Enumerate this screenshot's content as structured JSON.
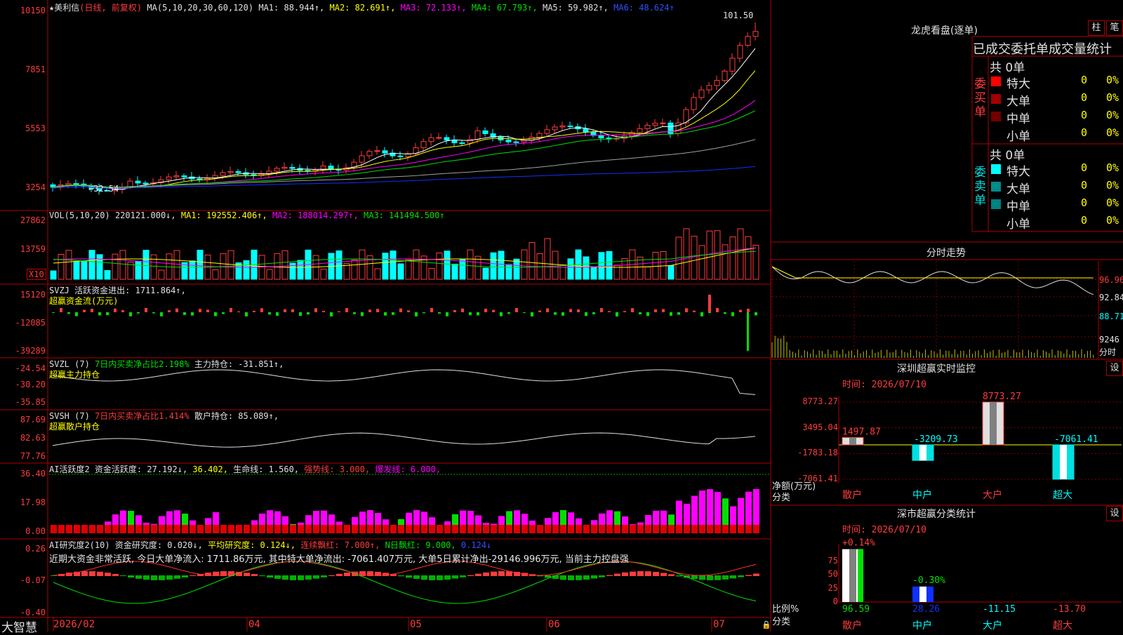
{
  "colors": {
    "up": "#ff3c3c",
    "down": "#00ffff",
    "ma1": "#ffffff",
    "ma2": "#ffff00",
    "ma3": "#ff00ff",
    "ma4": "#00e000",
    "ma5": "#a0a0a0",
    "ma6": "#1030ff",
    "frame": "#b00000"
  },
  "main": {
    "title_star": "★",
    "stock": "美利信",
    "mode": "(日线, 前复权)",
    "ma_def": "MA(5,10,20,30,60,120)",
    "ma1": "MA1: 88.944↑,",
    "ma2": "MA2: 82.691↑,",
    "ma3": "MA3: 72.133↑,",
    "ma4": "MA4: 67.793↑,",
    "ma5": "MA5: 59.982↑,",
    "ma6": "MA6: 48.624↑",
    "high_label": "101.50",
    "low_label": "←32.54",
    "y_ticks": [
      "10150",
      "7851",
      "5553",
      "3254"
    ]
  },
  "vol": {
    "title": "VOL(5,10,20)",
    "v": "220121.000↓,",
    "ma1": "MA1: 192552.406↑,",
    "ma2": "MA2: 188014.297↑,",
    "ma3": "MA3: 141494.500↑",
    "y_ticks": [
      "27862",
      "13759"
    ],
    "unit": "X10"
  },
  "svzj": {
    "title": "SVZJ",
    "line": "活跃资金进出: 1711.864↑,",
    "sub": "超赢资金流(万元)",
    "y_ticks": [
      "15120",
      "-12085",
      "-39289"
    ]
  },
  "svzl": {
    "title": "SVZL  (7)",
    "a": "7日内买卖净占比2.198%",
    "b": "主力持仓: -31.851↑,",
    "sub": "超赢主力持仓",
    "y_ticks": [
      "-24.54",
      "-30.20",
      "-35.85"
    ]
  },
  "svsh": {
    "title": "SVSH  (7)",
    "a": "7日内买卖净占比1.414%",
    "b": "散户持仓: 85.089↑,",
    "sub": "超赢散户持仓",
    "y_ticks": [
      "87.69",
      "82.63",
      "77.76"
    ]
  },
  "ai1": {
    "title": "AI活跃度2",
    "a": "资金活跃度: 27.192↓,",
    "b": "36.402,",
    "c": "生命线: 1.560,",
    "d": "强势线: 3.000,",
    "e": "爆发线: 6.000,",
    "y_ticks": [
      "36.40",
      "17.98",
      "0.00"
    ]
  },
  "ai2": {
    "title": "AI研究度2(10)",
    "a": "资金研究度: 0.020↓,",
    "b": "平均研究度: 0.124↓,",
    "c": "连续飘红: 7.000↑,",
    "d": "N日飘红: 9.000,",
    "e": "0.124↓",
    "comment": "近期大资金非常活跃, 今日大单净流入: 1711.86万元, 其中特大单净流出: -7061.407万元, 大单5日累计净出-29146.996万元, 当前主力控盘强",
    "y_ticks": [
      "0.26",
      "-0.07",
      "-0.40"
    ]
  },
  "xaxis": {
    "brand": "大智慧",
    "labels": [
      "2026/02",
      "04",
      "05",
      "06",
      "07"
    ]
  },
  "longhu": {
    "title": "龙虎看盘(逐单)",
    "btn1": "柱",
    "btn2": "笔",
    "header": "已成交委托单成交量统计",
    "buy_total": "共 0单",
    "sell_total": "共 0单",
    "buy_label": "委买单",
    "sell_label": "委卖单",
    "buy_rows": [
      {
        "name": "特大",
        "v": "0",
        "p": "0%",
        "c": "#ff0000"
      },
      {
        "name": "大单",
        "v": "0",
        "p": "0%",
        "c": "#a00000"
      },
      {
        "name": "中单",
        "v": "0",
        "p": "0%",
        "c": "#700000"
      },
      {
        "name": "小单",
        "v": "0",
        "p": "0%",
        "c": ""
      }
    ],
    "sell_rows": [
      {
        "name": "特大",
        "v": "0",
        "p": "0%",
        "c": "#00ffff"
      },
      {
        "name": "大单",
        "v": "0",
        "p": "0%",
        "c": "#008a8a"
      },
      {
        "name": "中单",
        "v": "0",
        "p": "0%",
        "c": "#008080"
      },
      {
        "name": "小单",
        "v": "0",
        "p": "0%",
        "c": ""
      }
    ]
  },
  "fenshi": {
    "title": "分时走势",
    "r1": "96.96",
    "r2": "92.84",
    "r3": "88.71",
    "vol": "9246",
    "unit": "分时"
  },
  "monitor": {
    "title": "深圳超赢实时监控",
    "btn": "设",
    "time": "时间: 2026/07/10",
    "y_ticks": [
      "8773.27",
      "3495.04",
      "-1783.18",
      "-7061.41"
    ],
    "ylabel": "净额(万元)",
    "xlabel": "分类",
    "categories": [
      "散户",
      "中户",
      "大户",
      "超大"
    ],
    "values": [
      1497.87,
      -3209.73,
      8773.27,
      -7061.41
    ],
    "value_labels": [
      "1497.87",
      "-3209.73",
      "8773.27",
      "-7061.41"
    ]
  },
  "classify": {
    "title": "深市超赢分类统计",
    "btn": "设",
    "time": "时间: 2026/07/10",
    "y_ticks": [
      "75",
      "50",
      "25",
      "0"
    ],
    "ylabel": "比例%",
    "xlabel": "分类",
    "categories": [
      "散户",
      "中户",
      "大户",
      "超大"
    ],
    "top_labels": [
      "+0.14%",
      "-0.30%",
      "",
      ""
    ],
    "values": [
      "96.59",
      "28.26",
      "-11.15",
      "-13.70"
    ]
  }
}
